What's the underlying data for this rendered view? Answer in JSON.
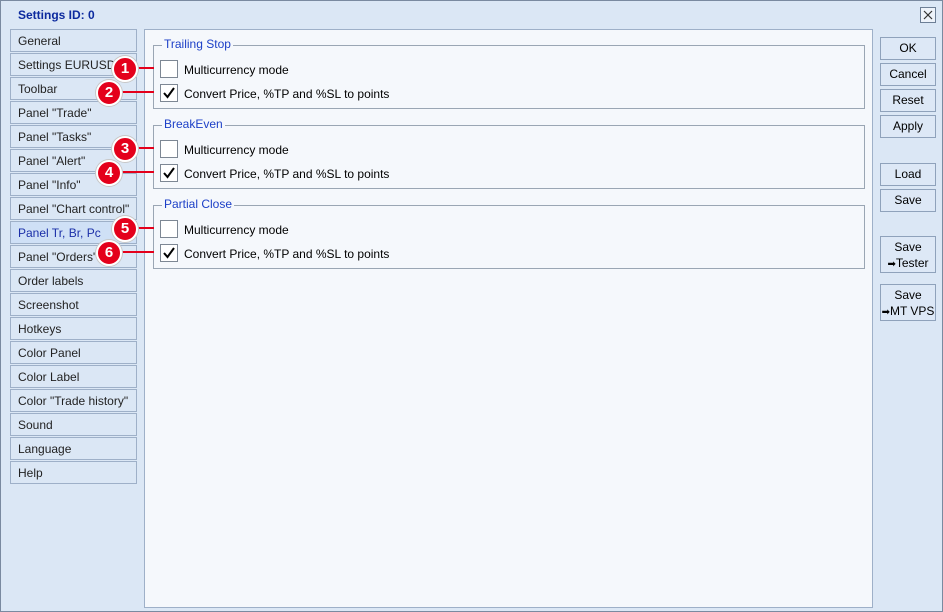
{
  "window": {
    "title": "Settings   ID: 0"
  },
  "sidebar": {
    "items": [
      {
        "label": "General"
      },
      {
        "label": "Settings EURUSD"
      },
      {
        "label": "Toolbar"
      },
      {
        "label": "Panel \"Trade\""
      },
      {
        "label": "Panel \"Tasks\""
      },
      {
        "label": "Panel \"Alert\""
      },
      {
        "label": "Panel \"Info\""
      },
      {
        "label": "Panel \"Chart control\""
      },
      {
        "label": "Panel Tr, Br, Pc"
      },
      {
        "label": "Panel \"Orders\""
      },
      {
        "label": "Order labels"
      },
      {
        "label": "Screenshot"
      },
      {
        "label": "Hotkeys"
      },
      {
        "label": "Color Panel"
      },
      {
        "label": "Color Label"
      },
      {
        "label": "Color \"Trade history\""
      },
      {
        "label": "Sound"
      },
      {
        "label": "Language"
      },
      {
        "label": "Help"
      }
    ],
    "active_index": 8
  },
  "groups": [
    {
      "title": "Trailing Stop",
      "options": [
        {
          "label": "Multicurrency mode",
          "checked": false
        },
        {
          "label": "Convert Price, %TP and %SL to points",
          "checked": true
        }
      ]
    },
    {
      "title": "BreakEven",
      "options": [
        {
          "label": "Multicurrency mode",
          "checked": false
        },
        {
          "label": "Convert Price, %TP and %SL to points",
          "checked": true
        }
      ]
    },
    {
      "title": "Partial Close",
      "options": [
        {
          "label": "Multicurrency mode",
          "checked": false
        },
        {
          "label": "Convert Price, %TP and %SL to points",
          "checked": true
        }
      ]
    }
  ],
  "buttons": {
    "ok": "OK",
    "cancel": "Cancel",
    "reset": "Reset",
    "apply": "Apply",
    "load": "Load",
    "save": "Save",
    "save_tester": {
      "line1": "Save",
      "line2": "Tester"
    },
    "save_vps": {
      "line1": "Save",
      "line2": "MT VPS"
    }
  },
  "annotations": [
    "1",
    "2",
    "3",
    "4",
    "5",
    "6"
  ],
  "colors": {
    "badge": "#e4001b",
    "group_title": "#1c3fc7",
    "window_title": "#0c2a9e"
  },
  "icons": {
    "close": "close-icon",
    "check": "checkmark-icon",
    "arrow": "right-arrow-icon"
  }
}
